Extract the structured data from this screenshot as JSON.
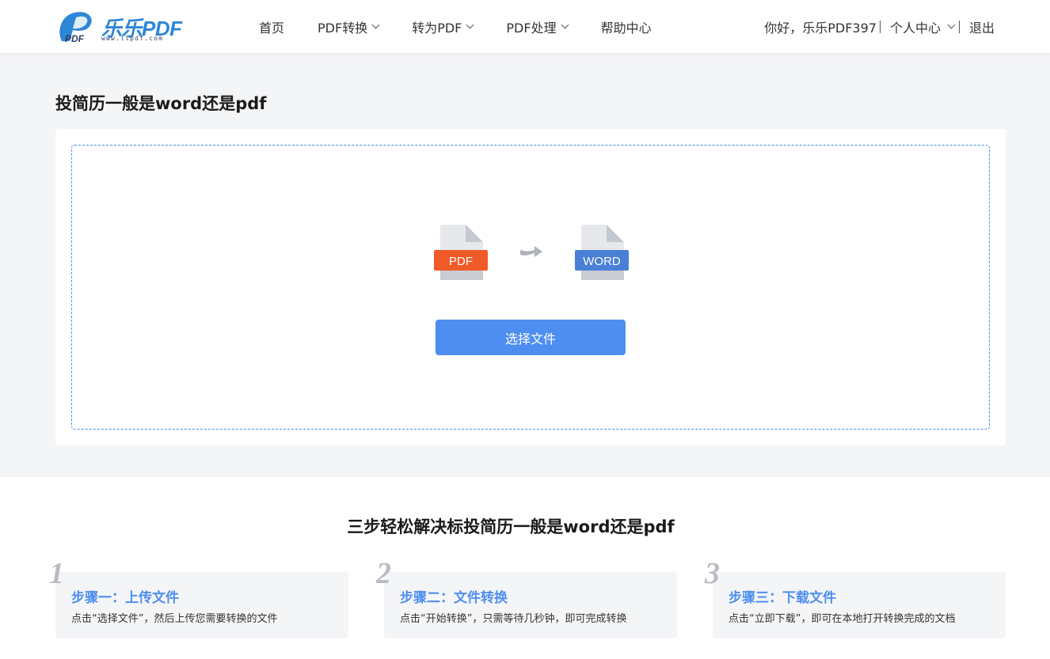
{
  "brand": {
    "logo_text": "乐乐PDF",
    "logo_url_text": "www.llpdf.com",
    "logo_mark_text": "PDF"
  },
  "nav": {
    "items": [
      {
        "label": "首页",
        "has_dropdown": false
      },
      {
        "label": "PDF转换",
        "has_dropdown": true
      },
      {
        "label": "转为PDF",
        "has_dropdown": true
      },
      {
        "label": "PDF处理",
        "has_dropdown": true
      },
      {
        "label": "帮助中心",
        "has_dropdown": false
      }
    ]
  },
  "user": {
    "greeting": "你好，乐乐PDF397",
    "center_label": "个人中心",
    "logout_label": "退出"
  },
  "main": {
    "title": "投简历一般是word还是pdf",
    "source_format": "PDF",
    "target_format": "WORD",
    "select_button": "选择文件"
  },
  "steps": {
    "title": "三步轻松解决标投简历一般是word还是pdf",
    "items": [
      {
        "number": "1",
        "heading": "步骤一：上传文件",
        "description": "点击“选择文件”，然后上传您需要转换的文件"
      },
      {
        "number": "2",
        "heading": "步骤二：文件转换",
        "description": "点击“开始转换”，只需等待几秒钟，即可完成转换"
      },
      {
        "number": "3",
        "heading": "步骤三：下载文件",
        "description": "点击“立即下载”，即可在本地打开转换完成的文档"
      }
    ]
  },
  "colors": {
    "accent": "#4e8ef0",
    "pdf_badge": "#f05a28",
    "word_badge": "#4a7fd6",
    "page_bg": "#f4f5f7"
  }
}
